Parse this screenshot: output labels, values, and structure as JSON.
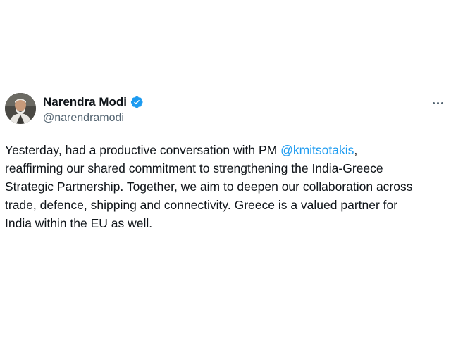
{
  "author": {
    "display_name": "Narendra Modi",
    "handle": "@narendramodi",
    "verified_badge_icon": "verified-badge-icon",
    "verified_badge_color": "#1d9bf0"
  },
  "menu": {
    "icon": "more-options-icon"
  },
  "post": {
    "line1_before": "Yesterday, had a productive conversation with PM ",
    "mention": "@kmitsotakis",
    "line1_after": ",",
    "line2": "reaffirming our shared commitment to strengthening the India-Greece",
    "line3": "Strategic Partnership. Together, we aim to deepen our collaboration across",
    "line4": "trade, defence, shipping and connectivity. Greece is a valued partner for",
    "line5": "India within the EU as well."
  },
  "colors": {
    "text": "#0f1419",
    "secondary_text": "#536471",
    "link": "#1d9bf0",
    "background": "#ffffff"
  }
}
